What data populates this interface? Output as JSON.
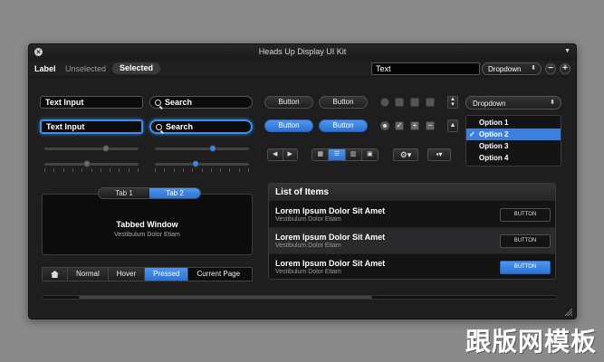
{
  "window": {
    "title": "Heads Up Display UI Kit"
  },
  "toolbar": {
    "label": "Label",
    "unselected": "Unselected",
    "selected": "Selected",
    "text_field": "Text",
    "dropdown": "Dropdown",
    "minus": "−",
    "plus": "+"
  },
  "inputs": {
    "text_input": "Text Input",
    "search": "Search",
    "text_input_focused": "Text Input",
    "search_focused": "Search"
  },
  "sliders": [
    {
      "level": 0.65
    },
    {
      "level": 0.62
    },
    {
      "level": 0.45
    },
    {
      "level": 0.43
    }
  ],
  "buttons": {
    "normal_1": "Button",
    "normal_2": "Button",
    "blue_1": "Button",
    "blue_2": "Button"
  },
  "dropdown": {
    "value": "Dropdown",
    "options": [
      "Option 1",
      "Option 2",
      "Option 3",
      "Option 4"
    ],
    "selected_index": 1
  },
  "tab_panel": {
    "tabs": [
      "Tab 1",
      "Tab 2"
    ],
    "active": 1,
    "title": "Tabbed Window",
    "subtitle": "Vestibulum Dolor Etiam"
  },
  "breadcrumb": {
    "items": [
      "Normal",
      "Hover",
      "Pressed",
      "Current Page"
    ],
    "pressed_index": 2
  },
  "list": {
    "title": "List of Items",
    "rows": [
      {
        "title": "Lorem Ipsum Dolor Sit Amet",
        "subtitle": "Vestibulum Dolor Etiam",
        "button": "BUTTON"
      },
      {
        "title": "Lorem Ipsum Dolor Sit Amet",
        "subtitle": "Vestibulum Dolor Etiam",
        "button": "BUTTON"
      },
      {
        "title": "Lorem Ipsum Dolor Sit Amet",
        "subtitle": "Vestibulum Dolor Etiam",
        "button": "BUTTON"
      }
    ]
  },
  "scrollbar": {
    "position": 0.07,
    "visible_fraction": 0.57
  },
  "watermark": "跟版网模板",
  "colors": {
    "accent": "#3b88e3",
    "background": "#1e1e1f",
    "page": "#8a8a8a"
  }
}
